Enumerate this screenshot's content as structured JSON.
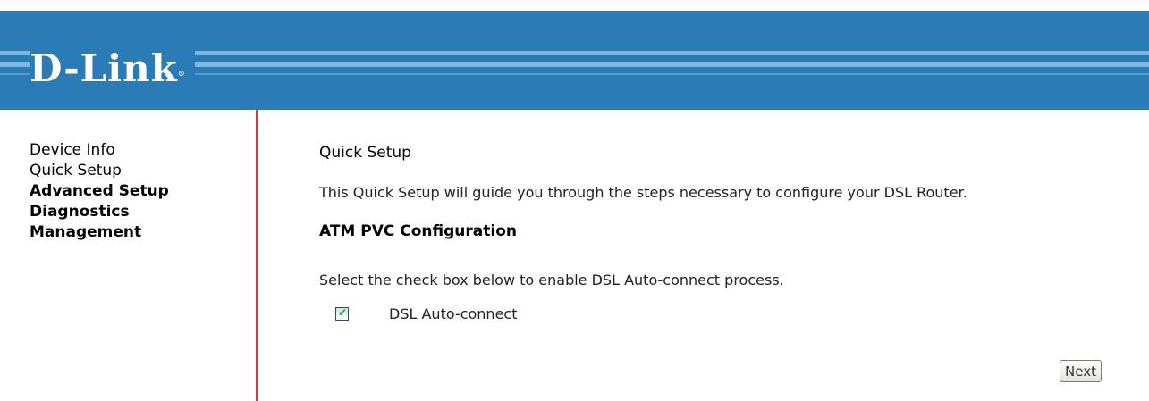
{
  "brand": {
    "logo_text": "D-Link",
    "registered_mark": "®"
  },
  "sidebar": {
    "items": [
      {
        "label": "Device Info",
        "bold": false
      },
      {
        "label": "Quick Setup",
        "bold": false
      },
      {
        "label": "Advanced Setup",
        "bold": true
      },
      {
        "label": "Diagnostics",
        "bold": true
      },
      {
        "label": "Management",
        "bold": true
      }
    ]
  },
  "main": {
    "title": "Quick Setup",
    "description": "This Quick Setup will guide you through the steps necessary to configure your DSL Router.",
    "section_title": "ATM PVC Configuration",
    "instruction": "Select the check box below to enable DSL Auto-connect process.",
    "auto_connect": {
      "label": "DSL Auto-connect",
      "checked": true
    },
    "next_label": "Next"
  },
  "colors": {
    "header_blue": "#2a7bb6",
    "header_stripe": "#7fb7dc",
    "divider_red": "#d8313f"
  }
}
